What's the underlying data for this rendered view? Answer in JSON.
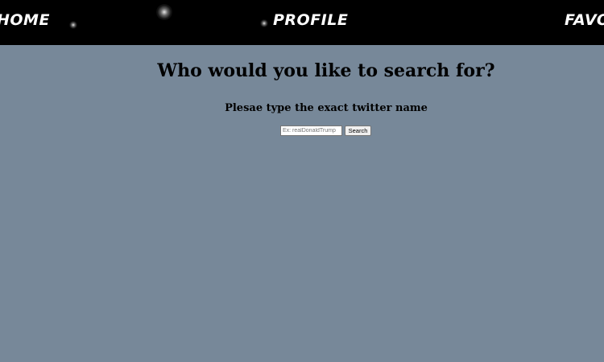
{
  "nav": {
    "home_label": "Home",
    "profile_label": "Profile",
    "favourites_label": "Favou"
  },
  "main": {
    "heading": "Who would you like to search for?",
    "subheading": "Plesae type the exact twitter name",
    "search": {
      "placeholder": "Ex: realDonaldTrump",
      "value": "",
      "button_label": "Search"
    }
  },
  "colors": {
    "page_background": "#778899",
    "navbar_background": "#000000",
    "nav_text": "#ffffff"
  }
}
